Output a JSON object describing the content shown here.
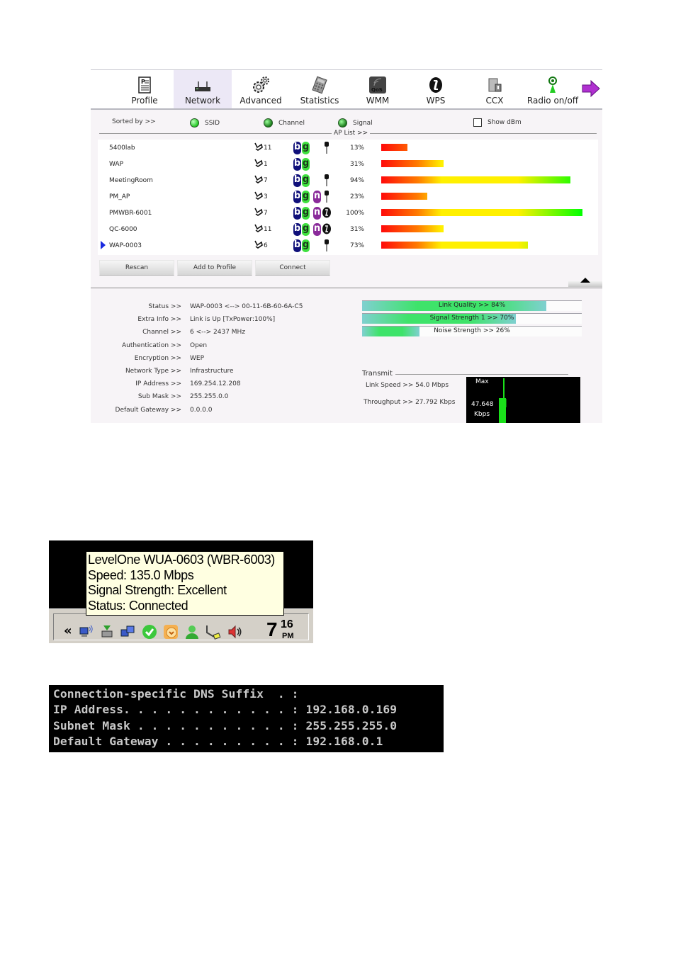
{
  "toolbar": {
    "items": [
      {
        "label": "Profile",
        "icon": "profile-icon"
      },
      {
        "label": "Network",
        "icon": "network-router-icon",
        "active": true
      },
      {
        "label": "Advanced",
        "icon": "gears-icon"
      },
      {
        "label": "Statistics",
        "icon": "calculator-icon"
      },
      {
        "label": "WMM",
        "icon": "qos-icon"
      },
      {
        "label": "WPS",
        "icon": "wps-icon"
      },
      {
        "label": "CCX",
        "icon": "ccx-icon"
      },
      {
        "label": "Radio on/off",
        "icon": "radio-antenna-icon"
      }
    ],
    "next_icon": "arrow-right-icon"
  },
  "sort": {
    "label": "Sorted by >>",
    "options": [
      {
        "label": "SSID",
        "selected": true
      },
      {
        "label": "Channel",
        "selected": false
      },
      {
        "label": "Signal",
        "selected": false
      }
    ],
    "show_dbm_label": "Show dBm",
    "show_dbm_checked": false,
    "ap_list_label": "AP List >>"
  },
  "ap_list": [
    {
      "ssid": "5400lab",
      "channel": "11",
      "modes": [
        "b",
        "g"
      ],
      "security": "key",
      "signal": "13%",
      "signal_value": 13,
      "selected": false
    },
    {
      "ssid": "WAP",
      "channel": "1",
      "modes": [
        "b",
        "g"
      ],
      "security": "",
      "signal": "31%",
      "signal_value": 31,
      "selected": false
    },
    {
      "ssid": "MeetingRoom",
      "channel": "7",
      "modes": [
        "b",
        "g"
      ],
      "security": "key",
      "signal": "94%",
      "signal_value": 94,
      "selected": false
    },
    {
      "ssid": "PM_AP",
      "channel": "3",
      "modes": [
        "b",
        "g",
        "n"
      ],
      "security": "key",
      "signal": "23%",
      "signal_value": 23,
      "selected": false
    },
    {
      "ssid": "PMWBR-6001",
      "channel": "7",
      "modes": [
        "b",
        "g",
        "n"
      ],
      "security": "wps",
      "signal": "100%",
      "signal_value": 100,
      "selected": false
    },
    {
      "ssid": "QC-6000",
      "channel": "11",
      "modes": [
        "b",
        "g",
        "n"
      ],
      "security": "wps",
      "signal": "31%",
      "signal_value": 31,
      "selected": false
    },
    {
      "ssid": "WAP-0003",
      "channel": "6",
      "modes": [
        "b",
        "g"
      ],
      "security": "key",
      "signal": "73%",
      "signal_value": 73,
      "selected": true
    }
  ],
  "buttons": {
    "rescan": "Rescan",
    "add_to_profile": "Add to Profile",
    "connect": "Connect"
  },
  "status": [
    {
      "label": "Status >>",
      "value": "WAP-0003 <--> 00-11-6B-60-6A-C5"
    },
    {
      "label": "Extra Info >>",
      "value": "Link is Up [TxPower:100%]"
    },
    {
      "label": "Channel >>",
      "value": "6 <--> 2437 MHz"
    },
    {
      "label": "Authentication >>",
      "value": "Open"
    },
    {
      "label": "Encryption >>",
      "value": "WEP"
    },
    {
      "label": "Network Type >>",
      "value": "Infrastructure"
    },
    {
      "label": "IP Address >>",
      "value": "169.254.12.208"
    },
    {
      "label": "Sub Mask >>",
      "value": "255.255.0.0"
    },
    {
      "label": "Default Gateway >>",
      "value": "0.0.0.0"
    }
  ],
  "meters": [
    {
      "label": "Link Quality >> 84%",
      "value": 84
    },
    {
      "label": "Signal Strength 1 >> 70%",
      "value": 70
    },
    {
      "label": "Noise Strength >> 26%",
      "value": 26
    }
  ],
  "transmit": {
    "title": "Transmit",
    "link_speed": "Link Speed >>  54.0 Mbps",
    "throughput": "Throughput >> 27.792 Kbps",
    "graph_max": "Max",
    "graph_value": "47.648",
    "graph_unit": "Kbps"
  },
  "tray": {
    "tooltip_lines": [
      "LevelOne WUA-0603 (WBR-6003)",
      "Speed: 135.0 Mbps",
      "Signal Strength: Excellent",
      "Status: Connected"
    ],
    "chevron": "«",
    "icons": [
      "wireless-network-icon",
      "safely-remove-icon",
      "network-connections-icon",
      "security-check-icon",
      "messenger-icon",
      "user-icon",
      "usb-plug-icon",
      "volume-icon"
    ],
    "clock_hour": "7",
    "clock_min": "16",
    "clock_ampm": "PM"
  },
  "console": {
    "lines": [
      "Connection-specific DNS Suffix  . :",
      "IP Address. . . . . . . . . . . . : 192.168.0.169",
      "Subnet Mask . . . . . . . . . . . : 255.255.255.0",
      "Default Gateway . . . . . . . . . : 192.168.0.1"
    ]
  }
}
